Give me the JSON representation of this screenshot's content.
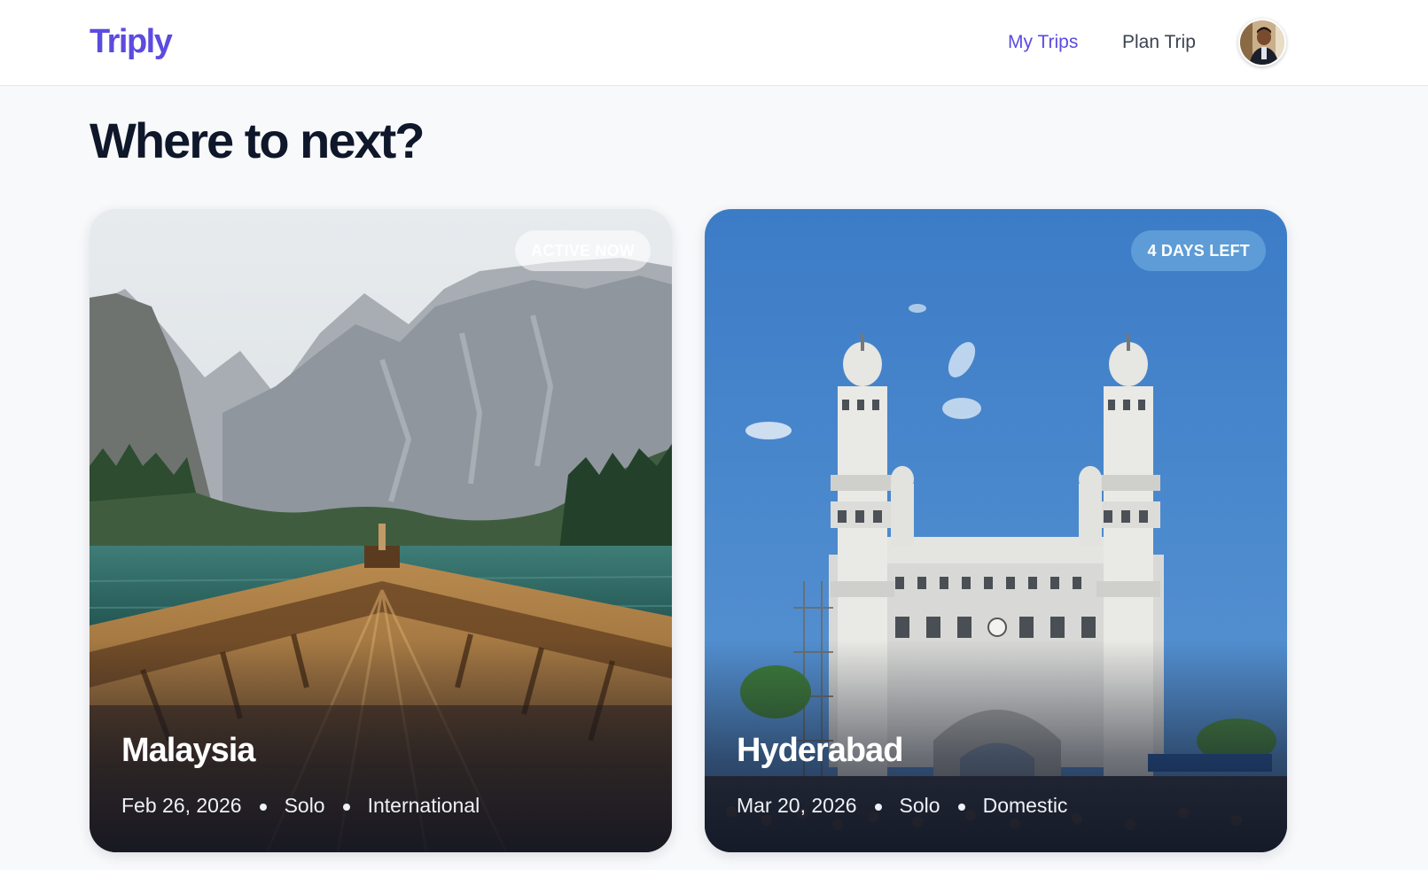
{
  "app": {
    "logo": "Triply"
  },
  "nav": {
    "my_trips": "My Trips",
    "plan_trip": "Plan Trip",
    "accent_color": "#5b4be0"
  },
  "main": {
    "title": "Where to next?"
  },
  "trips": [
    {
      "destination": "Malaysia",
      "badge": "ACTIVE NOW",
      "date": "Feb 26, 2026",
      "party": "Solo",
      "scope": "International"
    },
    {
      "destination": "Hyderabad",
      "badge": "4 DAYS LEFT",
      "date": "Mar 20, 2026",
      "party": "Solo",
      "scope": "Domestic"
    }
  ]
}
